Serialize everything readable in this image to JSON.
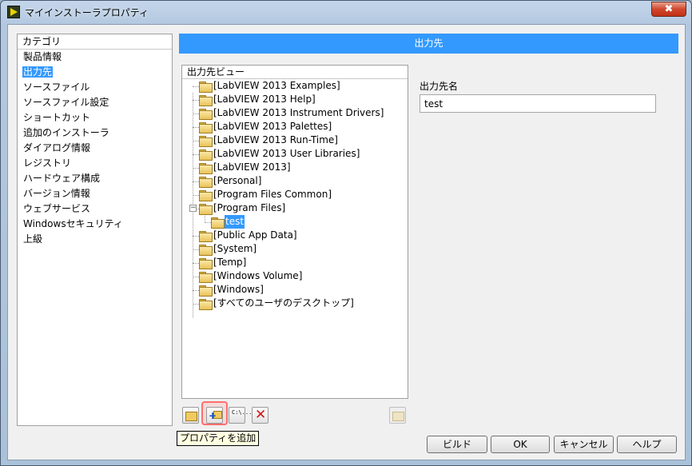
{
  "window": {
    "title": "マイインストーラプロパティ",
    "close_glyph": "✖"
  },
  "categories": {
    "header": "カテゴリ",
    "items": [
      {
        "label": "製品情報",
        "selected": false
      },
      {
        "label": "出力先",
        "selected": true
      },
      {
        "label": "ソースファイル",
        "selected": false
      },
      {
        "label": "ソースファイル設定",
        "selected": false
      },
      {
        "label": "ショートカット",
        "selected": false
      },
      {
        "label": "追加のインストーラ",
        "selected": false
      },
      {
        "label": "ダイアログ情報",
        "selected": false
      },
      {
        "label": "レジストリ",
        "selected": false
      },
      {
        "label": "ハードウェア構成",
        "selected": false
      },
      {
        "label": "バージョン情報",
        "selected": false
      },
      {
        "label": "ウェブサービス",
        "selected": false
      },
      {
        "label": "Windowsセキュリティ",
        "selected": false
      },
      {
        "label": "上級",
        "selected": false
      }
    ]
  },
  "banner": {
    "title": "出力先"
  },
  "tree": {
    "header": "出力先ビュー",
    "items": [
      {
        "label": "[LabVIEW 2013 Examples]"
      },
      {
        "label": "[LabVIEW 2013 Help]"
      },
      {
        "label": "[LabVIEW 2013 Instrument Drivers]"
      },
      {
        "label": "[LabVIEW 2013 Palettes]"
      },
      {
        "label": "[LabVIEW 2013 Run-Time]"
      },
      {
        "label": "[LabVIEW 2013 User Libraries]"
      },
      {
        "label": "[LabVIEW 2013]"
      },
      {
        "label": "[Personal]"
      },
      {
        "label": "[Program Files Common]"
      },
      {
        "label": "[Program Files]",
        "expanded": true
      },
      {
        "label": "test",
        "child": true,
        "selected": true
      },
      {
        "label": "[Public App Data]"
      },
      {
        "label": "[System]"
      },
      {
        "label": "[Temp]"
      },
      {
        "label": "[Windows Volume]"
      },
      {
        "label": "[Windows]"
      },
      {
        "label": "[すべてのユーザのデスクトップ]"
      }
    ],
    "collapse_glyph": "−"
  },
  "toolbar": {
    "delete_glyph": "✕",
    "dir_glyph": "C:\\...",
    "add_glyph": "+"
  },
  "tooltip": {
    "text": "プロパティを追加"
  },
  "destination": {
    "label": "出力先名",
    "value": "test"
  },
  "buttons": {
    "build": "ビルド",
    "ok": "OK",
    "cancel": "キャンセル",
    "help": "ヘルプ"
  },
  "colors": {
    "accent": "#3399ff",
    "highlight": "#ff6f6f"
  }
}
